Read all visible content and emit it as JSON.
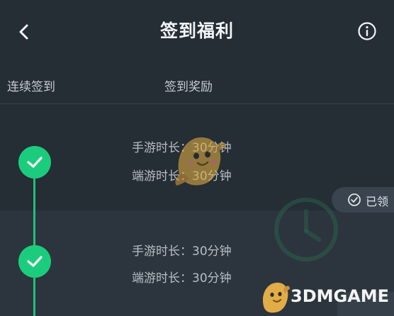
{
  "header": {
    "title": "签到福利",
    "back_icon": "chevron-left-icon",
    "info_icon": "info-circle-icon"
  },
  "columns": {
    "left": "连续签到",
    "right": "签到奖励"
  },
  "rows": [
    {
      "status_icon": "check-icon",
      "mobile_reward": "手游时长：30分钟",
      "pc_reward": "端游时长：30分钟",
      "claim_label": "已领"
    },
    {
      "status_icon": "check-icon",
      "mobile_reward": "手游时长：30分钟",
      "pc_reward": "端游时长：30分钟"
    }
  ],
  "watermark": {
    "text": "3DMGAME",
    "mascot_icon": "bird-mascot-icon"
  },
  "colors": {
    "background": "#252d35",
    "row_alt": "#2c353e",
    "accent_green": "#1ccc7d",
    "text_muted": "#b7bec5"
  }
}
